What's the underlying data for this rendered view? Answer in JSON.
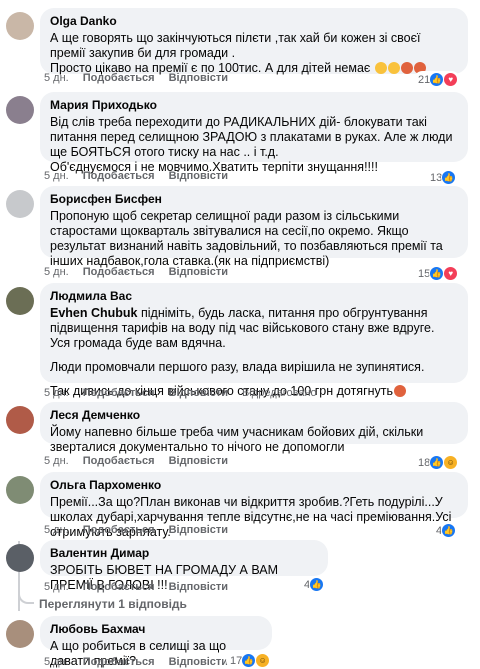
{
  "comments": [
    {
      "author": "Olga Danko",
      "lines": [
        "А ще говорять що закінчуються пілєти ,так хай би кожен зі своєї премії закупив би для громади .",
        "Просто цікаво на премії є по 100тис. А для дітей немає"
      ],
      "emojis": [
        "sad-face",
        "crying-face",
        "angry-face",
        "angry-face"
      ],
      "time": "5 дн.",
      "like": "Подобається",
      "reply": "Відповісти",
      "reaction_count": "21",
      "reactions": [
        "like",
        "love"
      ]
    },
    {
      "author": "Мария Приходько",
      "lines": [
        "Від слів треба переходити до РАДИКАЛЬНИХ дій- блокувати такі питання перед селищною ЗРАДОЮ з плакатами в руках. Але ж люди ще БОЯТЬСЯ отого тиску на нас .. і т.д.",
        "Об'єднуємося і не мовчимо.Хватить терпіти знущання!!!!"
      ],
      "time": "5 дн.",
      "like": "Подобається",
      "reply": "Відповісти",
      "reaction_count": "13",
      "reactions": [
        "like"
      ]
    },
    {
      "author": "Борисфен Бисфен",
      "lines": [
        "Пропоную щоб секретар селищної ради разом із сільськими старостами щокварталь звітувалися на сесії,по окремо. Якщо результат визнаний навіть задовільний, то позбавляються премії та інших надбавок,гола ставка.(як на підприємстві)"
      ],
      "time": "5 дн.",
      "like": "Подобається",
      "reply": "Відповісти",
      "reaction_count": "15",
      "reactions": [
        "like",
        "love"
      ]
    },
    {
      "author": "Людмила Вас",
      "mention": "Evhen Chubuk",
      "lines": [
        "підніміть, будь ласка, питання про обгрунтування підвищення тарифів на воду під час військового стану вже вдруге.",
        "Уся громада буде вам вдячна.",
        "Люди промовчали першого разу, влада вирішила не зупинятися.",
        "Так дивись до кінця військового стану до 100 грн дотягнуть"
      ],
      "time": "5 дн.",
      "like": "Подобається",
      "reply": "Відповісти",
      "edited": "Відредаговано"
    },
    {
      "author": "Леся Демченко",
      "lines": [
        "Йому напевно більше треба чим учасникам бойових дій, скільки зверталися документально то нічого не допомогли"
      ],
      "time": "5 дн.",
      "like": "Подобається",
      "reply": "Відповісти",
      "reaction_count": "18",
      "reactions": [
        "like",
        "haha"
      ]
    },
    {
      "author": "Ольга Пархоменко",
      "lines": [
        "Премії...За що?План виконав чи відкриття зробив.?Геть подурілі...У школах дубарі,харчування тепле відсутнє,не на часі преміювання.Усі отримують зарплату."
      ],
      "time": "5 дн.",
      "like": "Подобається",
      "reply": "Відповісти",
      "reaction_count": "4",
      "reactions": [
        "like"
      ]
    },
    {
      "author": "Валентин Димар",
      "lines": [
        "ЗРОБІТЬ БЮВЕТ НА ГРОМАДУ А ВАМ ПРЕМІЇ В ГОЛОВІ !!!"
      ],
      "time": "5 дн.",
      "like": "Подобається",
      "reply": "Відповісти",
      "reaction_count": "4",
      "reactions": [
        "like"
      ]
    },
    {
      "author": "Любовь Бахмач",
      "lines": [
        "А що робиться в селищі за що давати премії?"
      ],
      "time": "5 дн.",
      "like": "Подобається",
      "reply": "Відповісти",
      "reaction_count": "17",
      "reactions": [
        "like",
        "haha"
      ]
    }
  ],
  "view_replies": "Переглянути 1 відповідь",
  "colors": {
    "bubble": "#f0f2f5",
    "meta": "#65676b",
    "like_blue": "#1877f2",
    "love_red": "#f33e58"
  }
}
